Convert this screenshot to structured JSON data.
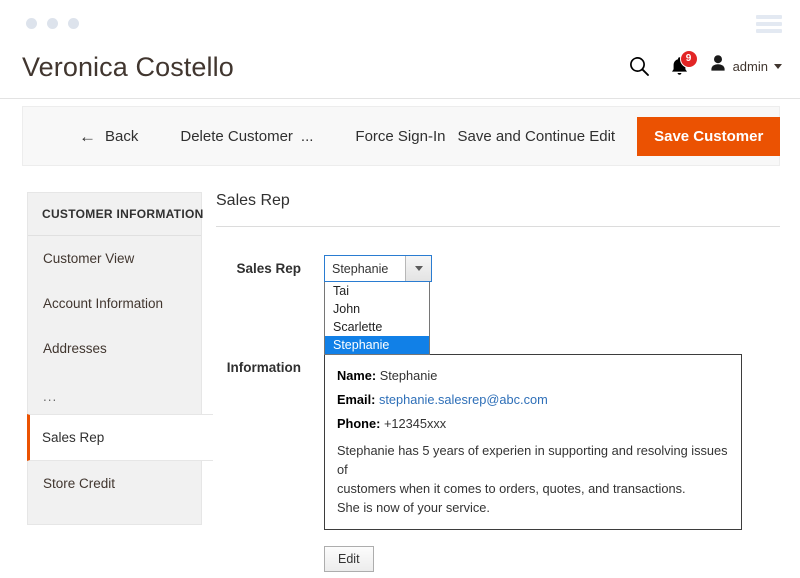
{
  "window": {
    "dots": [
      "dot-1",
      "dot-2",
      "dot-3"
    ],
    "menu_icon": "hamburger-icon"
  },
  "header": {
    "title": "Veronica Costello",
    "search_icon": "search-icon",
    "notifications_icon": "bell-icon",
    "notifications_count": "9",
    "user_icon": "user-avatar-icon",
    "user_name": "admin",
    "caret_icon": "chevron-down-icon"
  },
  "toolbar": {
    "back_arrow": "←",
    "back_label": "Back",
    "delete_label": "Delete Customer",
    "more_label": "...",
    "force_signin_label": "Force Sign-In",
    "save_continue_label": "Save and Continue Edit",
    "save_customer_label": "Save Customer",
    "primary_color": "#eb5202"
  },
  "sidebar": {
    "title": "CUSTOMER INFORMATION",
    "active_accent": "#eb5202",
    "items": [
      {
        "label": "Customer View",
        "active": false
      },
      {
        "label": "Account Information",
        "active": false
      },
      {
        "label": "Addresses",
        "active": false
      },
      {
        "label": "...",
        "active": false
      },
      {
        "label": "Sales Rep",
        "active": true
      },
      {
        "label": "Store Credit",
        "active": false
      }
    ]
  },
  "main": {
    "section_title": "Sales Rep",
    "sales_rep_field": {
      "label": "Sales Rep",
      "selected": "Stephanie",
      "focus_color": "#2a7cd1",
      "highlight_color": "#1180e7",
      "options": [
        "Tai",
        "John",
        "Scarlette",
        "Stephanie"
      ]
    },
    "information_field": {
      "label": "Information",
      "name_label": "Name:",
      "name_value": "Stephanie",
      "email_label": "Email:",
      "email_value": "stephanie.salesrep@abc.com",
      "phone_label": "Phone:",
      "phone_value": "+12345xxx",
      "description_line1": "Stephanie has 5 years of experien in supporting and resolving issues of",
      "description_line2": "customers when it comes to orders, quotes, and transactions.",
      "description_line3": "She is now of your service."
    },
    "edit_label": "Edit"
  }
}
